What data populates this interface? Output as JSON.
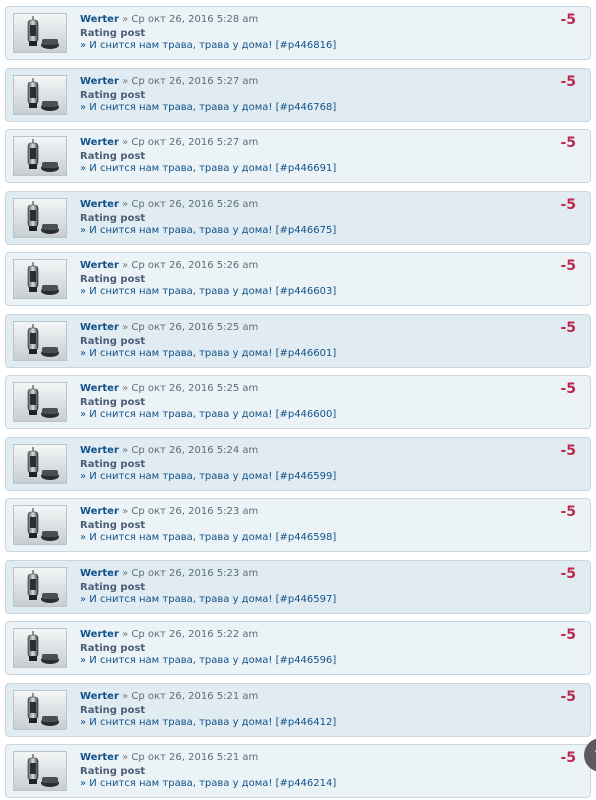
{
  "posts": [
    {
      "author": "Werter",
      "sep": "»",
      "date": "Ср окт 26, 2016 5:28 am",
      "action": "Rating post",
      "topic": "» И снится нам трава, трава у дома! [#p446816]",
      "score": "-5"
    },
    {
      "author": "Werter",
      "sep": "»",
      "date": "Ср окт 26, 2016 5:27 am",
      "action": "Rating post",
      "topic": "» И снится нам трава, трава у дома! [#p446768]",
      "score": "-5"
    },
    {
      "author": "Werter",
      "sep": "»",
      "date": "Ср окт 26, 2016 5:27 am",
      "action": "Rating post",
      "topic": "» И снится нам трава, трава у дома! [#p446691]",
      "score": "-5"
    },
    {
      "author": "Werter",
      "sep": "»",
      "date": "Ср окт 26, 2016 5:26 am",
      "action": "Rating post",
      "topic": "» И снится нам трава, трава у дома! [#p446675]",
      "score": "-5"
    },
    {
      "author": "Werter",
      "sep": "»",
      "date": "Ср окт 26, 2016 5:26 am",
      "action": "Rating post",
      "topic": "» И снится нам трава, трава у дома! [#p446603]",
      "score": "-5"
    },
    {
      "author": "Werter",
      "sep": "»",
      "date": "Ср окт 26, 2016 5:25 am",
      "action": "Rating post",
      "topic": "» И снится нам трава, трава у дома! [#p446601]",
      "score": "-5"
    },
    {
      "author": "Werter",
      "sep": "»",
      "date": "Ср окт 26, 2016 5:25 am",
      "action": "Rating post",
      "topic": "» И снится нам трава, трава у дома! [#p446600]",
      "score": "-5"
    },
    {
      "author": "Werter",
      "sep": "»",
      "date": "Ср окт 26, 2016 5:24 am",
      "action": "Rating post",
      "topic": "» И снится нам трава, трава у дома! [#p446599]",
      "score": "-5"
    },
    {
      "author": "Werter",
      "sep": "»",
      "date": "Ср окт 26, 2016 5:23 am",
      "action": "Rating post",
      "topic": "» И снится нам трава, трава у дома! [#p446598]",
      "score": "-5"
    },
    {
      "author": "Werter",
      "sep": "»",
      "date": "Ср окт 26, 2016 5:23 am",
      "action": "Rating post",
      "topic": "» И снится нам трава, трава у дома! [#p446597]",
      "score": "-5"
    },
    {
      "author": "Werter",
      "sep": "»",
      "date": "Ср окт 26, 2016 5:22 am",
      "action": "Rating post",
      "topic": "» И снится нам трава, трава у дома! [#p446596]",
      "score": "-5"
    },
    {
      "author": "Werter",
      "sep": "»",
      "date": "Ср окт 26, 2016 5:21 am",
      "action": "Rating post",
      "topic": "» И снится нам трава, трава у дома! [#p446412]",
      "score": "-5"
    },
    {
      "author": "Werter",
      "sep": "»",
      "date": "Ср окт 26, 2016 5:21 am",
      "action": "Rating post",
      "topic": "» И снится нам трава, трава у дома! [#p446214]",
      "score": "-5"
    }
  ],
  "scroll_button": {
    "icon": "chevron-up-icon",
    "glyph": "⌃"
  },
  "colors": {
    "author": "#105289",
    "score": "#bc2a4d",
    "row_odd": "#ecf3f7",
    "row_even": "#e1ebf2"
  }
}
